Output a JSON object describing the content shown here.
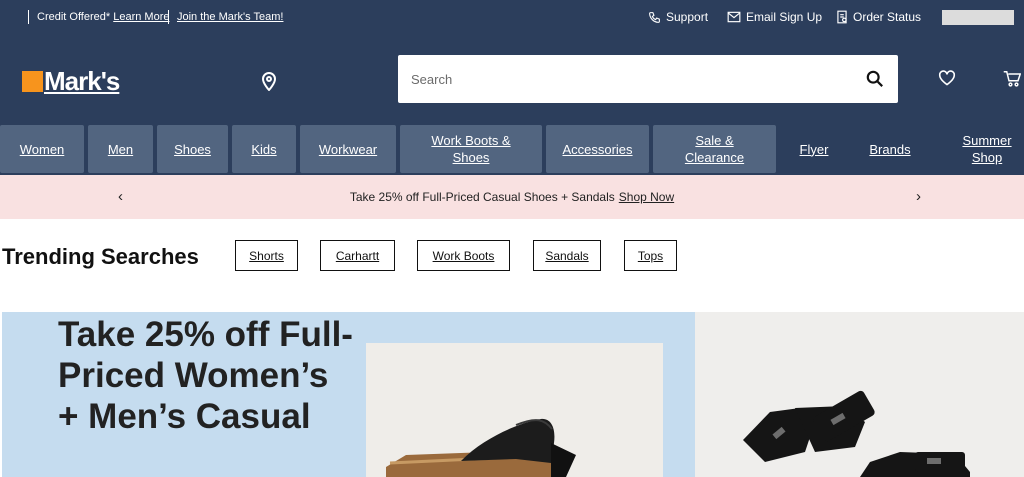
{
  "topbar": {
    "credit_text": "Credit Offered*",
    "learn_more": "Learn More",
    "join_team": "Join the Mark's Team!",
    "support": "Support",
    "email_signup": "Email Sign Up",
    "order_status": "Order Status"
  },
  "header": {
    "logo_text": "Mark's",
    "search_placeholder": "Search"
  },
  "nav": {
    "items": [
      {
        "label": "Women"
      },
      {
        "label": "Men"
      },
      {
        "label": "Shoes"
      },
      {
        "label": "Kids"
      },
      {
        "label": "Workwear"
      },
      {
        "label": "Work Boots & Shoes"
      },
      {
        "label": "Accessories"
      },
      {
        "label": "Sale & Clearance"
      },
      {
        "label": "Flyer"
      },
      {
        "label": "Brands"
      },
      {
        "label": "Summer Shop"
      }
    ]
  },
  "promo": {
    "prev": "‹",
    "next": "›",
    "message": "Take 25% off Full-Priced Casual Shoes + Sandals",
    "link": "Shop Now"
  },
  "trending": {
    "title": "Trending Searches",
    "chips": [
      "Shorts",
      "Carhartt",
      "Work Boots",
      "Sandals",
      "Tops"
    ]
  },
  "hero": {
    "headline": "Take 25% off Full-Priced Women’s + Men’s Casual"
  },
  "colors": {
    "navy": "#2c3e5c",
    "nav_tab": "#526580",
    "brand_orange": "#f7941d",
    "promo_bg": "#f9e1e1",
    "hero_blue": "#c5dcef"
  },
  "icons": [
    "phone-icon",
    "envelope-icon",
    "receipt-icon",
    "location-pin-icon",
    "search-icon",
    "heart-icon",
    "cart-icon"
  ]
}
